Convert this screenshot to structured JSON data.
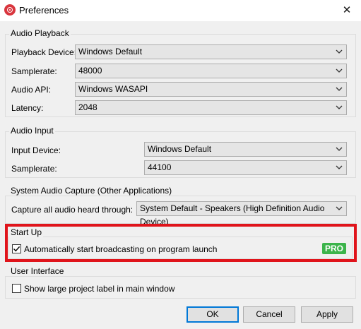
{
  "window": {
    "title": "Preferences",
    "close_glyph": "✕"
  },
  "audio_playback": {
    "title": "Audio Playback",
    "playback_device": {
      "label": "Playback Device:",
      "value": "Windows Default"
    },
    "samplerate": {
      "label": "Samplerate:",
      "value": "48000"
    },
    "audio_api": {
      "label": "Audio API:",
      "value": "Windows WASAPI"
    },
    "latency": {
      "label": "Latency:",
      "value": "2048"
    }
  },
  "audio_input": {
    "title": "Audio Input",
    "input_device": {
      "label": "Input Device:",
      "value": "Windows Default"
    },
    "samplerate": {
      "label": "Samplerate:",
      "value": "44100"
    }
  },
  "system_audio_capture": {
    "title": "System Audio Capture (Other Applications)",
    "capture": {
      "label": "Capture all audio heard through:",
      "value": "System Default - Speakers (High Definition Audio Device)"
    }
  },
  "start_up": {
    "title": "Start Up",
    "auto_broadcast": {
      "label": "Automatically start broadcasting on program launch",
      "checked": true
    },
    "pro_badge": "PRO",
    "highlight_color": "#e0141b"
  },
  "user_interface": {
    "title": "User Interface",
    "large_label": {
      "label": "Show large project label in main window",
      "checked": false
    }
  },
  "buttons": {
    "ok": "OK",
    "cancel": "Cancel",
    "apply": "Apply"
  },
  "colors": {
    "pro_badge": "#3cb44b",
    "default_button_border": "#0078d7",
    "app_icon": "#d9363e"
  }
}
